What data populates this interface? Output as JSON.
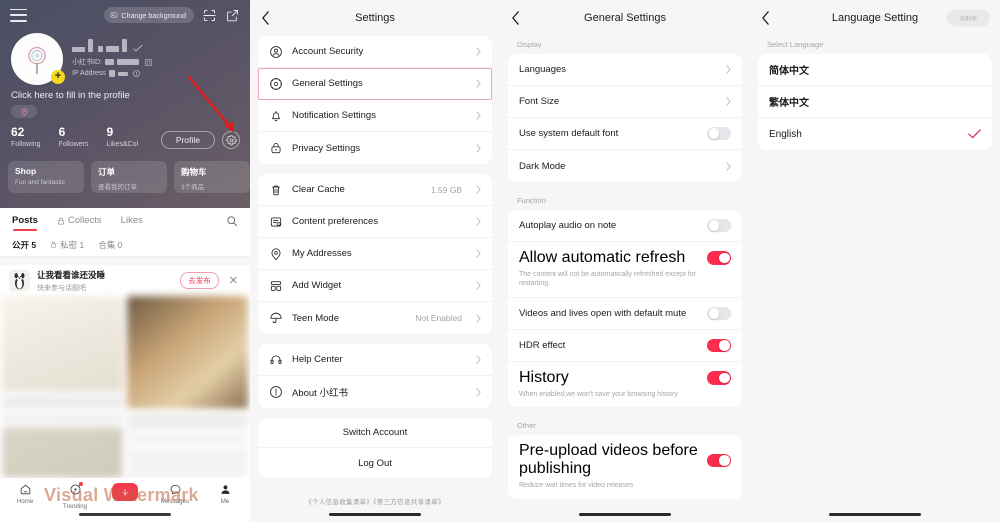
{
  "profile": {
    "topbar": {
      "change_background": "Change background"
    },
    "fill_profile_hint": "Click here to fill in the profile",
    "id_label": "小红书ID:",
    "ip_label": "IP Address",
    "stats": [
      {
        "value": "62",
        "label": "Following"
      },
      {
        "value": "6",
        "label": "Followers"
      },
      {
        "value": "9",
        "label": "Likes&Col"
      }
    ],
    "profile_button": "Profile",
    "shop_cards": [
      {
        "title": "Shop",
        "sub": "Fun and fantastic"
      },
      {
        "title": "订单",
        "sub": "查看我的订单"
      },
      {
        "title": "购物车",
        "sub": "3个商品"
      }
    ],
    "tabs": [
      {
        "label": "Posts",
        "active": true
      },
      {
        "label": "Collects",
        "active": false
      },
      {
        "label": "Likes",
        "active": false
      }
    ],
    "subtabs": [
      {
        "label": "公开 5",
        "active": true
      },
      {
        "label": "私密 1",
        "active": false
      },
      {
        "label": "合集 0",
        "active": false
      }
    ],
    "topic": {
      "title": "让我看看谁还没睡",
      "sub": "快来参与话题吧",
      "cta": "去发布"
    },
    "bottom_nav": [
      {
        "label": "Home"
      },
      {
        "label": "Trending"
      },
      {
        "label": ""
      },
      {
        "label": "Messages"
      },
      {
        "label": "Me"
      }
    ],
    "watermark": "Visual Watermark"
  },
  "settings": {
    "title": "Settings",
    "group1": [
      {
        "label": "Account Security",
        "icon": "account-security-icon",
        "value": ""
      },
      {
        "label": "General Settings",
        "icon": "gear-icon",
        "value": "",
        "highlighted": true
      },
      {
        "label": "Notification Settings",
        "icon": "bell-icon",
        "value": ""
      },
      {
        "label": "Privacy Settings",
        "icon": "lock-icon",
        "value": ""
      }
    ],
    "group2": [
      {
        "label": "Clear Cache",
        "icon": "trash-icon",
        "value": "1.59 GB"
      },
      {
        "label": "Content preferences",
        "icon": "content-prefs-icon",
        "value": ""
      },
      {
        "label": "My Addresses",
        "icon": "location-icon",
        "value": ""
      },
      {
        "label": "Add Widget",
        "icon": "widget-icon",
        "value": ""
      },
      {
        "label": "Teen Mode",
        "icon": "umbrella-icon",
        "value": "Not Enabled"
      }
    ],
    "group3": [
      {
        "label": "Help Center",
        "icon": "headset-icon",
        "value": ""
      },
      {
        "label": "About 小红书",
        "icon": "info-icon",
        "value": ""
      }
    ],
    "group4": [
      {
        "label": "Switch Account"
      },
      {
        "label": "Log Out"
      }
    ],
    "legal": "《个人信息收集清单》《第三方信息共享清单》"
  },
  "general": {
    "title": "General Settings",
    "section_display": "Display",
    "display_rows": [
      {
        "label": "Languages",
        "type": "chevron"
      },
      {
        "label": "Font Size",
        "type": "chevron"
      },
      {
        "label": "Use system default font",
        "type": "toggle",
        "on": false
      },
      {
        "label": "Dark Mode",
        "type": "chevron"
      }
    ],
    "section_function": "Function",
    "function_rows": [
      {
        "label": "Autoplay audio on note",
        "type": "toggle",
        "on": false,
        "sub": ""
      },
      {
        "label": "Allow automatic refresh",
        "type": "toggle",
        "on": true,
        "sub": "The content will not be automatically refreshed except for restarting."
      },
      {
        "label": "Videos and lives open with default mute",
        "type": "toggle",
        "on": false,
        "sub": ""
      },
      {
        "label": "HDR effect",
        "type": "toggle",
        "on": true,
        "sub": ""
      },
      {
        "label": "History",
        "type": "toggle",
        "on": true,
        "sub": "When enabled,we won't save your browsing history"
      }
    ],
    "section_other": "Other",
    "other_rows": [
      {
        "label": "Pre-upload videos before publishing",
        "type": "toggle",
        "on": true,
        "sub": "Reduce wait times for video releases"
      }
    ]
  },
  "language": {
    "title": "Language Setting",
    "save_label": "save",
    "section_label": "Select Language",
    "options": [
      {
        "label": "简体中文",
        "selected": false
      },
      {
        "label": "繁体中文",
        "selected": false
      },
      {
        "label": "English",
        "selected": true
      }
    ]
  },
  "colors": {
    "accent_red": "#fb2c4e",
    "tab_underline": "#f03b52",
    "check_red": "#d9304e",
    "panel_bg": "#f6f6f6",
    "card_bg": "#ffffff"
  }
}
